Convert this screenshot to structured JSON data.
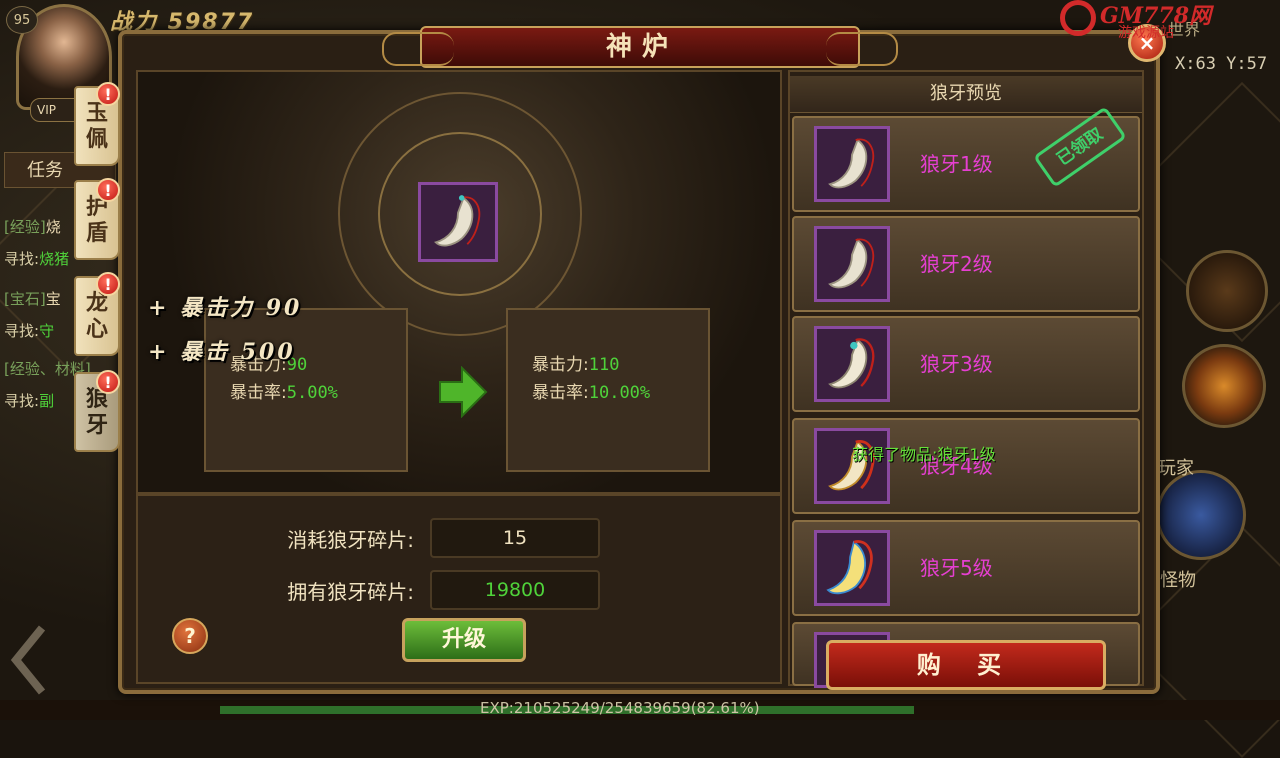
{
  "hud": {
    "player_level": "95",
    "vip": "VIP",
    "combat_power": "战力  59877",
    "task_label": "任务",
    "quest_lines": [
      {
        "text": "[经验]",
        "extra": "烧"
      },
      {
        "text": "寻找:",
        "extra": "烧猪"
      },
      {
        "text": "[宝石]",
        "extra": "宝"
      },
      {
        "text": "寻找:",
        "extra": "守"
      },
      {
        "text": "[经验、材料]",
        "extra": ""
      },
      {
        "text": "寻找:",
        "extra": "副"
      }
    ],
    "map_name": "世界",
    "coords": "X:63 Y:57",
    "players_label": "玩家",
    "monster_label": "怪物",
    "exp_text": "EXP:210525249/254839659(82.61%)",
    "exp_progress": 0.8261
  },
  "logo": {
    "text": "GM778网",
    "sub": "游戏源站"
  },
  "side_tabs": [
    {
      "label_1": "玉",
      "label_2": "佩",
      "badge": "!"
    },
    {
      "label_1": "护",
      "label_2": "盾",
      "badge": "!"
    },
    {
      "label_1": "龙",
      "label_2": "心",
      "badge": "!"
    },
    {
      "label_1": "狼",
      "label_2": "牙",
      "badge": "!"
    }
  ],
  "window": {
    "title": "神炉",
    "close": "×"
  },
  "upgrade": {
    "float_1": "+ 暴击力 90",
    "float_2": "+  暴击  500",
    "current": {
      "crit_power_label": "暴击力:",
      "crit_power_value": "90",
      "crit_rate_label": "暴击率:",
      "crit_rate_value": "5.00%"
    },
    "next": {
      "crit_power_label": "暴击力:",
      "crit_power_value": "110",
      "crit_rate_label": "暴击率:",
      "crit_rate_value": "10.00%"
    },
    "cost_label": "消耗狼牙碎片:",
    "cost_value": "15",
    "owned_label": "拥有狼牙碎片:",
    "owned_value": "19800",
    "help": "?",
    "upgrade_button": "升级",
    "colors": {
      "stat_value": "#4fd23a",
      "owned_value": "#4fd23a"
    }
  },
  "preview": {
    "title": "狼牙预览",
    "items": [
      {
        "label": "狼牙1级"
      },
      {
        "label": "狼牙2级"
      },
      {
        "label": "狼牙3级"
      },
      {
        "label": "狼牙4级"
      },
      {
        "label": "狼牙5级"
      }
    ],
    "claimed_stamp": "已领取",
    "obtain_msg": "获得了物品:狼牙1级",
    "buy_button": "购 买"
  }
}
